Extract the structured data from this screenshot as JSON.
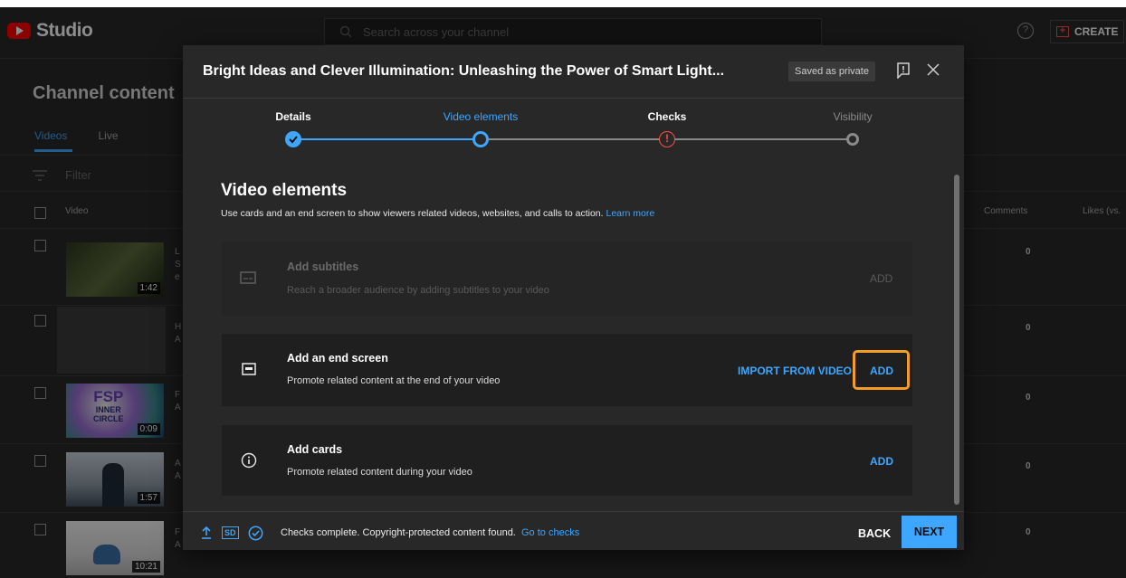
{
  "app": {
    "logo_text": "Studio",
    "search_placeholder": "Search across your channel",
    "help_glyph": "?",
    "create_label": "CREATE"
  },
  "channel": {
    "title": "Channel content",
    "tabs": [
      {
        "label": "Videos"
      },
      {
        "label": "Live"
      }
    ],
    "filter_label": "Filter",
    "columns": {
      "video": "Video",
      "comments": "Comments",
      "likes": "Likes (vs."
    },
    "rows": [
      {
        "duration": "1:42",
        "title_initial": "L",
        "desc_1": "S",
        "desc_2": "e",
        "comments": "0"
      },
      {
        "duration": "",
        "title_initial": "H",
        "desc_1": "A",
        "desc_2": "",
        "comments": "0"
      },
      {
        "duration": "0:09",
        "title_initial": "F",
        "desc_1": "A",
        "desc_2": "",
        "comments": "0",
        "thumb_text_1": "FSP",
        "thumb_text_2": "INNER",
        "thumb_text_3": "CIRCLE"
      },
      {
        "duration": "1:57",
        "title_initial": "A",
        "desc_1": "A",
        "desc_2": "",
        "comments": "0"
      },
      {
        "duration": "10:21",
        "title_initial": "F",
        "desc_1": "A",
        "desc_2": "",
        "comments": "0"
      }
    ]
  },
  "modal": {
    "title": "Bright Ideas and Clever Illumination: Unleashing the Power of Smart Light...",
    "status_chip": "Saved as private",
    "steps": [
      {
        "label": "Details",
        "state": "done"
      },
      {
        "label": "Video elements",
        "state": "current"
      },
      {
        "label": "Checks",
        "state": "warning"
      },
      {
        "label": "Visibility",
        "state": "pending"
      }
    ],
    "section_title": "Video elements",
    "section_desc": "Use cards and an end screen to show viewers related videos, websites, and calls to action.",
    "learn_more": "Learn more",
    "cards": [
      {
        "title": "Add subtitles",
        "desc": "Reach a broader audience by adding subtitles to your video",
        "action": "ADD",
        "enabled": false,
        "icon": "subtitles-icon"
      },
      {
        "title": "Add an end screen",
        "desc": "Promote related content at the end of your video",
        "secondary_action": "IMPORT FROM VIDEO",
        "action": "ADD",
        "enabled": true,
        "icon": "end-screen-icon"
      },
      {
        "title": "Add cards",
        "desc": "Promote related content during your video",
        "action": "ADD",
        "enabled": true,
        "icon": "info-icon"
      }
    ],
    "footer": {
      "sd_badge": "SD",
      "status": "Checks complete. Copyright-protected content found.",
      "go_to_checks": "Go to checks",
      "back": "BACK",
      "next": "NEXT"
    }
  },
  "colors": {
    "accent": "#3ea6ff",
    "warning": "#ff4e45",
    "highlight": "#f39c26",
    "surface": "#282828",
    "card": "#1f1f1f"
  }
}
